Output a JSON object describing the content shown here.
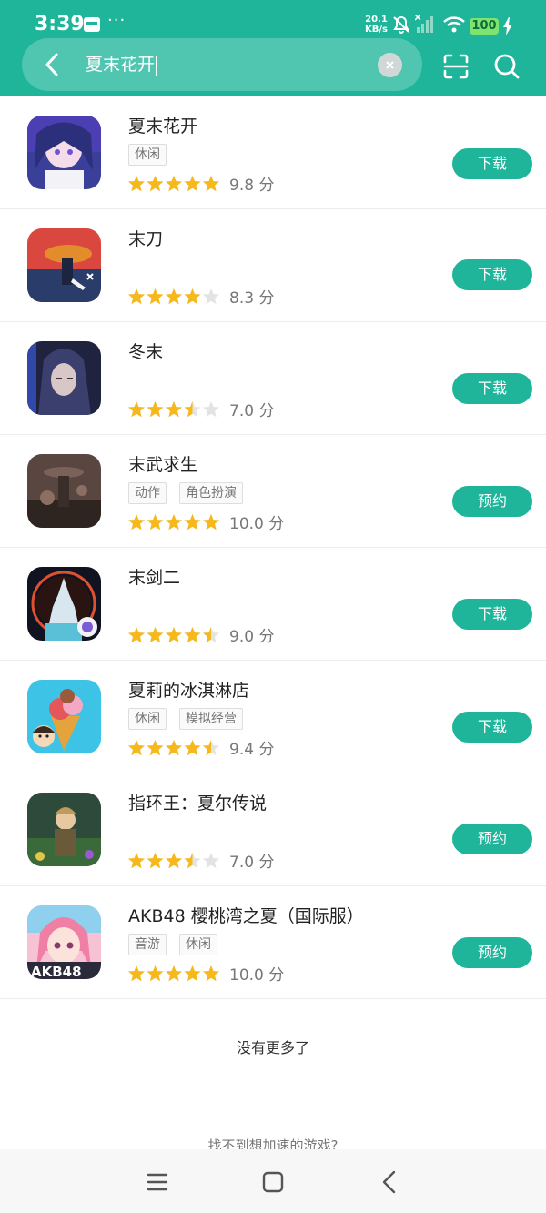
{
  "status_bar": {
    "time": "3:39",
    "more": "···",
    "net_speed_value": "20.1",
    "net_speed_unit": "KB/s",
    "battery": "100"
  },
  "search": {
    "query": "夏末花开"
  },
  "colors": {
    "accent": "#1fb59a",
    "star_on": "#f6b81a",
    "star_off": "#e3e3e3"
  },
  "results": [
    {
      "name": "夏末花开",
      "tags": [
        "休闲"
      ],
      "rating": 5,
      "score": "9.8 分",
      "action": "下载"
    },
    {
      "name": "末刀",
      "tags": [],
      "rating": 4,
      "score": "8.3 分",
      "action": "下载"
    },
    {
      "name": "冬末",
      "tags": [],
      "rating": 3.5,
      "score": "7.0 分",
      "action": "下载"
    },
    {
      "name": "末武求生",
      "tags": [
        "动作",
        "角色扮演"
      ],
      "rating": 5,
      "score": "10.0 分",
      "action": "预约"
    },
    {
      "name": "末剑二",
      "tags": [],
      "rating": 4.5,
      "score": "9.0 分",
      "action": "下载"
    },
    {
      "name": "夏莉的冰淇淋店",
      "tags": [
        "休闲",
        "模拟经营"
      ],
      "rating": 4.5,
      "score": "9.4 分",
      "action": "下载"
    },
    {
      "name": "指环王：夏尔传说",
      "tags": [],
      "rating": 3.5,
      "score": "7.0 分",
      "action": "预约"
    },
    {
      "name": "AKB48 樱桃湾之夏（国际服）",
      "tags": [
        "音游",
        "休闲"
      ],
      "rating": 5,
      "score": "10.0 分",
      "action": "预约"
    }
  ],
  "footer": {
    "no_more": "没有更多了",
    "help": "找不到想加速的游戏?"
  }
}
